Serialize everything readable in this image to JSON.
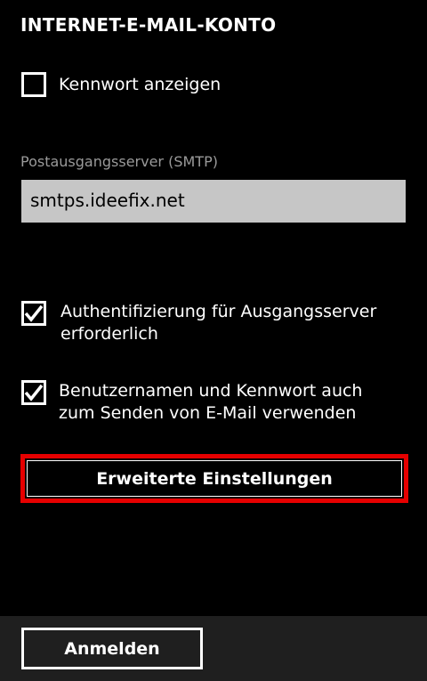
{
  "page": {
    "title": "INTERNET-E-MAIL-KONTO"
  },
  "show_password": {
    "label": "Kennwort anzeigen",
    "checked": false
  },
  "smtp": {
    "label": "Postausgangsserver (SMTP)",
    "value": "smtps.ideefix.net"
  },
  "auth_required": {
    "label_line1": "Authentifizierung für Ausgangsserver",
    "label_line2": "erforderlich",
    "checked": true
  },
  "use_credentials": {
    "label_line1": "Benutzernamen und Kennwort auch",
    "label_line2": "zum Senden von E-Mail verwenden",
    "checked": true
  },
  "advanced_settings": {
    "label": "Erweiterte Einstellungen"
  },
  "app_bar": {
    "signin_label": "Anmelden"
  },
  "colors": {
    "background": "#000000",
    "highlight": "#e60000",
    "input_background": "#c6c6c6",
    "app_bar": "#1f1f1f"
  }
}
